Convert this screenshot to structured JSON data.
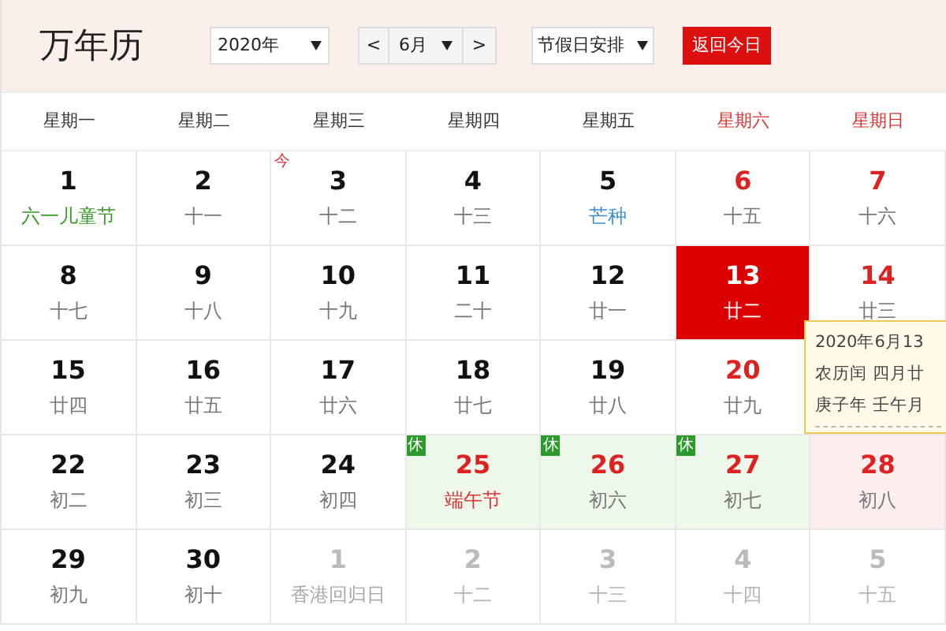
{
  "header": {
    "title": "万年历",
    "year_select": "2020年",
    "prev": "<",
    "month_select": "6月",
    "next": ">",
    "holiday_select": "节假日安排",
    "today_button": "返回今日"
  },
  "weekdays": [
    {
      "label": "星期一",
      "weekend": false
    },
    {
      "label": "星期二",
      "weekend": false
    },
    {
      "label": "星期三",
      "weekend": false
    },
    {
      "label": "星期四",
      "weekend": false
    },
    {
      "label": "星期五",
      "weekend": false
    },
    {
      "label": "星期六",
      "weekend": true
    },
    {
      "label": "星期日",
      "weekend": true
    }
  ],
  "weeks": [
    [
      {
        "day": "1",
        "note": "六一儿童节",
        "kind": "festival",
        "red": false,
        "selected": false,
        "other_month": false
      },
      {
        "day": "2",
        "note": "十一",
        "kind": "lunar",
        "red": false,
        "selected": false,
        "other_month": false
      },
      {
        "day": "3",
        "note": "十二",
        "kind": "lunar",
        "red": false,
        "selected": false,
        "other_month": false,
        "badge": "今"
      },
      {
        "day": "4",
        "note": "十三",
        "kind": "lunar",
        "red": false,
        "selected": false,
        "other_month": false
      },
      {
        "day": "5",
        "note": "芒种",
        "kind": "term",
        "red": false,
        "selected": false,
        "other_month": false
      },
      {
        "day": "6",
        "note": "十五",
        "kind": "lunar",
        "red": true,
        "selected": false,
        "other_month": false
      },
      {
        "day": "7",
        "note": "十六",
        "kind": "lunar",
        "red": true,
        "selected": false,
        "other_month": false
      }
    ],
    [
      {
        "day": "8",
        "note": "十七",
        "kind": "lunar",
        "red": false,
        "selected": false,
        "other_month": false
      },
      {
        "day": "9",
        "note": "十八",
        "kind": "lunar",
        "red": false,
        "selected": false,
        "other_month": false
      },
      {
        "day": "10",
        "note": "十九",
        "kind": "lunar",
        "red": false,
        "selected": false,
        "other_month": false
      },
      {
        "day": "11",
        "note": "二十",
        "kind": "lunar",
        "red": false,
        "selected": false,
        "other_month": false
      },
      {
        "day": "12",
        "note": "廿一",
        "kind": "lunar",
        "red": false,
        "selected": false,
        "other_month": false
      },
      {
        "day": "13",
        "note": "廿二",
        "kind": "lunar",
        "selected": true,
        "other_month": false
      },
      {
        "day": "14",
        "note": "廿三",
        "kind": "lunar",
        "red": true,
        "selected": false,
        "other_month": false
      }
    ],
    [
      {
        "day": "15",
        "note": "廿四",
        "kind": "lunar",
        "red": false,
        "selected": false,
        "other_month": false
      },
      {
        "day": "16",
        "note": "廿五",
        "kind": "lunar",
        "red": false,
        "selected": false,
        "other_month": false
      },
      {
        "day": "17",
        "note": "廿六",
        "kind": "lunar",
        "red": false,
        "selected": false,
        "other_month": false
      },
      {
        "day": "18",
        "note": "廿七",
        "kind": "lunar",
        "red": false,
        "selected": false,
        "other_month": false
      },
      {
        "day": "19",
        "note": "廿八",
        "kind": "lunar",
        "red": false,
        "selected": false,
        "other_month": false
      },
      {
        "day": "20",
        "note": "廿九",
        "kind": "lunar",
        "red": true,
        "selected": false,
        "other_month": false
      }
    ],
    [
      {
        "day": "22",
        "note": "初二",
        "kind": "lunar",
        "red": false,
        "selected": false,
        "other_month": false
      },
      {
        "day": "23",
        "note": "初三",
        "kind": "lunar",
        "red": false,
        "selected": false,
        "other_month": false
      },
      {
        "day": "24",
        "note": "初四",
        "kind": "lunar",
        "red": false,
        "selected": false,
        "other_month": false
      },
      {
        "day": "25",
        "note": "端午节",
        "kind": "holiday",
        "red": true,
        "selected": false,
        "other_month": false,
        "rest": "休"
      },
      {
        "day": "26",
        "note": "初六",
        "kind": "lunar",
        "red": true,
        "selected": false,
        "other_month": false,
        "rest": "休"
      },
      {
        "day": "27",
        "note": "初七",
        "kind": "lunar",
        "red": true,
        "selected": false,
        "other_month": false,
        "rest": "休"
      },
      {
        "day": "28",
        "note": "初八",
        "kind": "lunar",
        "red": true,
        "selected": false,
        "other_month": false,
        "tinted": true
      }
    ],
    [
      {
        "day": "29",
        "note": "初九",
        "kind": "lunar",
        "red": false,
        "selected": false,
        "other_month": false
      },
      {
        "day": "30",
        "note": "初十",
        "kind": "lunar",
        "red": false,
        "selected": false,
        "other_month": false
      },
      {
        "day": "1",
        "note": "香港回归日",
        "kind": "festival",
        "red": false,
        "selected": false,
        "other_month": true
      },
      {
        "day": "2",
        "note": "十二",
        "kind": "lunar",
        "red": false,
        "selected": false,
        "other_month": true
      },
      {
        "day": "3",
        "note": "十三",
        "kind": "lunar",
        "red": false,
        "selected": false,
        "other_month": true
      },
      {
        "day": "4",
        "note": "十四",
        "kind": "lunar",
        "red": true,
        "selected": false,
        "other_month": true
      },
      {
        "day": "5",
        "note": "十五",
        "kind": "lunar",
        "red": true,
        "selected": false,
        "other_month": true
      }
    ]
  ],
  "tooltip": {
    "lines": [
      "2020年6月13",
      "农历闰 四月廿",
      "庚子年 壬午月"
    ]
  }
}
